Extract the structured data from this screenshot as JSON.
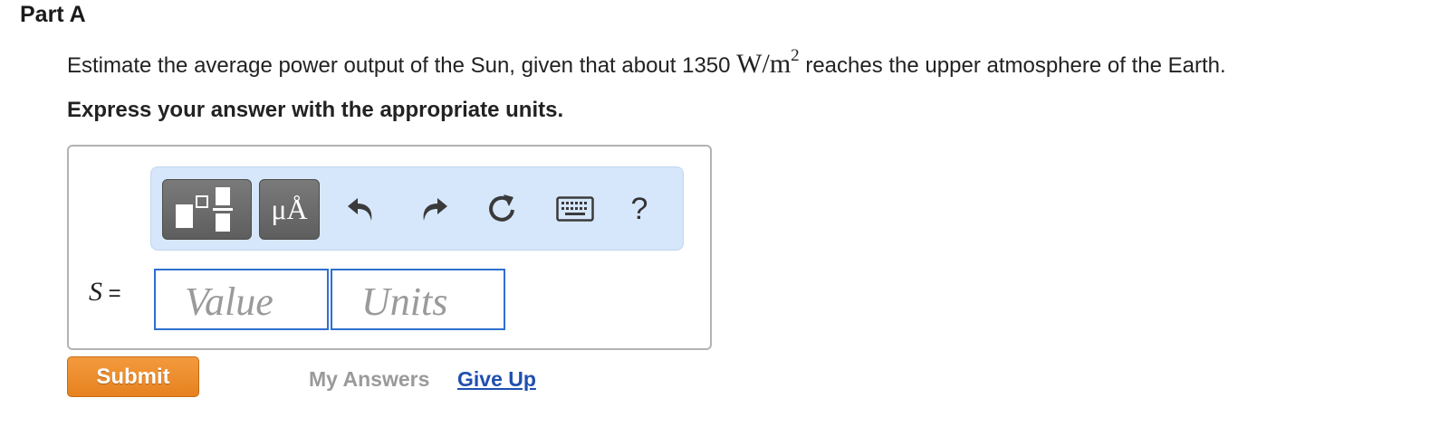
{
  "part": {
    "title": "Part A"
  },
  "question": {
    "text_before": "Estimate the average power output of the Sun, given that about 1350 ",
    "unit_main": "W/m",
    "unit_exp": "2",
    "text_after": " reaches the upper atmosphere of the Earth."
  },
  "instruction": "Express your answer with the appropriate units.",
  "toolbar": {
    "units_label": "μÅ",
    "help_label": "?"
  },
  "answer": {
    "variable": "S",
    "equals": " =",
    "value_placeholder": "Value",
    "units_placeholder": "Units"
  },
  "actions": {
    "submit_label": "Submit",
    "my_answers_label": "My Answers",
    "give_up_label": "Give Up"
  },
  "colors": {
    "toolbar_bg": "#d6e6fb",
    "input_border": "#2e6fcf",
    "submit_bg": "#e88a2a",
    "link": "#1f4fb0"
  }
}
